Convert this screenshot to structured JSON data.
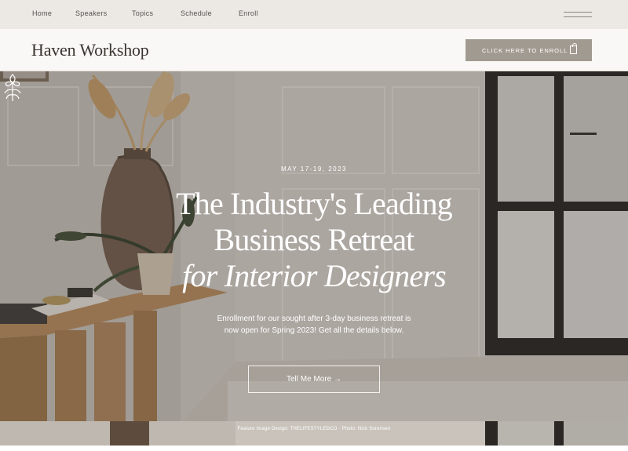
{
  "nav": {
    "items": [
      {
        "label": "Home"
      },
      {
        "label": "Speakers"
      },
      {
        "label": "Topics"
      },
      {
        "label": "Schedule"
      },
      {
        "label": "Enroll"
      }
    ],
    "menu_icon": "hamburger-icon"
  },
  "header": {
    "brand": "Haven Workshop",
    "enroll_button": "CLICK HERE TO ENROLL",
    "enroll_icon": "shopping-bag-icon"
  },
  "hero": {
    "emblem_icon": "floral-emblem-icon",
    "date": "MAY 17-19, 2023",
    "headline_line1": "The Industry's Leading",
    "headline_line2": "Business Retreat",
    "headline_line3": "for Interior Designers",
    "description_line1": "Enrollment for our sought after 3-day business retreat is",
    "description_line2": "now open for Spring 2023! Get all the details below.",
    "cta": "Tell Me More →"
  },
  "footer": {
    "credit": "Feature Image Design: THELIFESTYLEDCO · Photo: Nick Sorensen"
  },
  "colors": {
    "nav_bg": "#ece8e3",
    "header_bg": "#f9f8f6",
    "button_bg": "#a19a91",
    "text_dark": "#3a3530"
  }
}
